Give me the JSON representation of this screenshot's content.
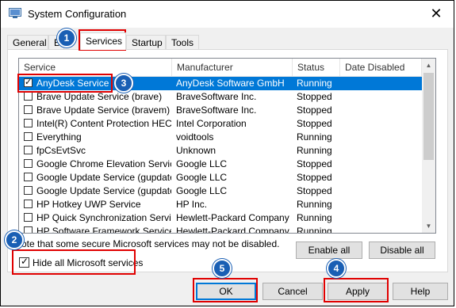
{
  "window": {
    "title": "System Configuration",
    "close_glyph": "✕"
  },
  "tabs": [
    "General",
    "B",
    "Services",
    "Startup",
    "Tools"
  ],
  "columns": [
    "Service",
    "Manufacturer",
    "Status",
    "Date Disabled"
  ],
  "services": [
    {
      "name": "AnyDesk Service",
      "manufacturer": "AnyDesk Software GmbH",
      "status": "Running",
      "checked": true,
      "selected": true
    },
    {
      "name": "Brave Update Service (brave)",
      "manufacturer": "BraveSoftware Inc.",
      "status": "Stopped",
      "checked": false
    },
    {
      "name": "Brave Update Service (bravem)",
      "manufacturer": "BraveSoftware Inc.",
      "status": "Stopped",
      "checked": false
    },
    {
      "name": "Intel(R) Content Protection HEC...",
      "manufacturer": "Intel Corporation",
      "status": "Stopped",
      "checked": false
    },
    {
      "name": "Everything",
      "manufacturer": "voidtools",
      "status": "Running",
      "checked": false
    },
    {
      "name": "fpCsEvtSvc",
      "manufacturer": "Unknown",
      "status": "Running",
      "checked": false
    },
    {
      "name": "Google Chrome Elevation Servic...",
      "manufacturer": "Google LLC",
      "status": "Stopped",
      "checked": false
    },
    {
      "name": "Google Update Service (gupdate)",
      "manufacturer": "Google LLC",
      "status": "Stopped",
      "checked": false
    },
    {
      "name": "Google Update Service (gupdatem)",
      "manufacturer": "Google LLC",
      "status": "Stopped",
      "checked": false
    },
    {
      "name": "HP Hotkey UWP Service",
      "manufacturer": "HP Inc.",
      "status": "Running",
      "checked": false
    },
    {
      "name": "HP Quick Synchronization Service",
      "manufacturer": "Hewlett-Packard Company",
      "status": "Running",
      "checked": false
    },
    {
      "name": "HP Software Framework Service",
      "manufacturer": "Hewlett-Packard Company",
      "status": "Running",
      "checked": false
    }
  ],
  "note": "ote that some secure Microsoft services may not be disabled.",
  "buttons": {
    "enable_all": "Enable all",
    "disable_all": "Disable all",
    "ok": "OK",
    "cancel": "Cancel",
    "apply": "Apply",
    "help": "Help"
  },
  "hide_label": "Hide all Microsoft services",
  "hide_checked": true,
  "badges": [
    "1",
    "2",
    "3",
    "4",
    "5"
  ],
  "colors": {
    "selection": "#0078d7",
    "highlight": "#e00000",
    "badge": "#1a5fb4"
  }
}
